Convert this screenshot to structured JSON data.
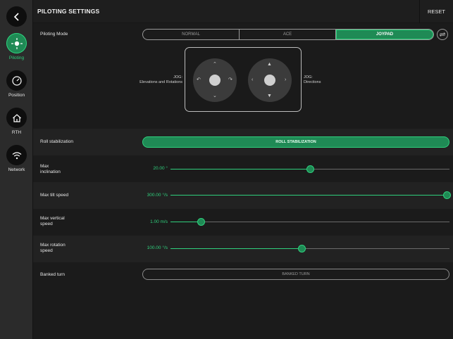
{
  "header": {
    "title": "PILOTING SETTINGS",
    "reset_label": "RESET"
  },
  "sidebar": {
    "items": [
      {
        "label": "Piloting",
        "icon": "piloting-icon",
        "active": true
      },
      {
        "label": "Position",
        "icon": "gauge-icon",
        "active": false
      },
      {
        "label": "RTH",
        "icon": "home-icon",
        "active": false
      },
      {
        "label": "Network",
        "icon": "wifi-icon",
        "active": false
      }
    ]
  },
  "piloting_mode": {
    "label": "Piloting Mode",
    "options": [
      "NORMAL",
      "ACE",
      "JOYPAD"
    ],
    "selected": "JOYPAD"
  },
  "joystick": {
    "left_label_line1": "JOG:",
    "left_label_line2": "Elevations and Rotations",
    "right_label_line1": "JOG:",
    "right_label_line2": "Directions"
  },
  "roll_stabilization": {
    "label": "Roll stabilization",
    "button_label": "ROLL STABILIZATION",
    "on": true
  },
  "sliders": [
    {
      "label_line1": "Max",
      "label_line2": "inclination",
      "value_text": "20.00 °",
      "fraction": 0.5
    },
    {
      "label_line1": "Max tilt speed",
      "label_line2": "",
      "value_text": "300.00 °/s",
      "fraction": 1.0
    },
    {
      "label_line1": "Max vertical",
      "label_line2": "speed",
      "value_text": "1.00 m/s",
      "fraction": 0.11
    },
    {
      "label_line1": "Max rotation",
      "label_line2": "speed",
      "value_text": "100.00 °/s",
      "fraction": 0.47
    }
  ],
  "banked_turn": {
    "label": "Banked turn",
    "button_label": "BANKED TURN",
    "on": false
  },
  "colors": {
    "accent": "#2fd07d",
    "accent_dark": "#1f8a55",
    "background": "#1b1b1b",
    "sidebar": "#2b2b2b"
  }
}
